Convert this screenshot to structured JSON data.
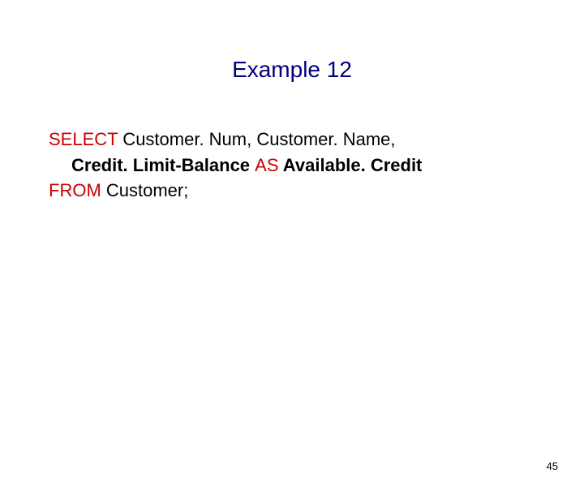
{
  "slide": {
    "title": "Example 12",
    "page_number": "45"
  },
  "sql": {
    "kw_select": "SELECT",
    "line1_rest": " Customer. Num, Customer. Name,",
    "line2_expr": "Credit. Limit-Balance ",
    "kw_as": "AS",
    "line2_alias": " Available. Credit",
    "kw_from": "FROM",
    "line3_rest": " Customer;"
  }
}
